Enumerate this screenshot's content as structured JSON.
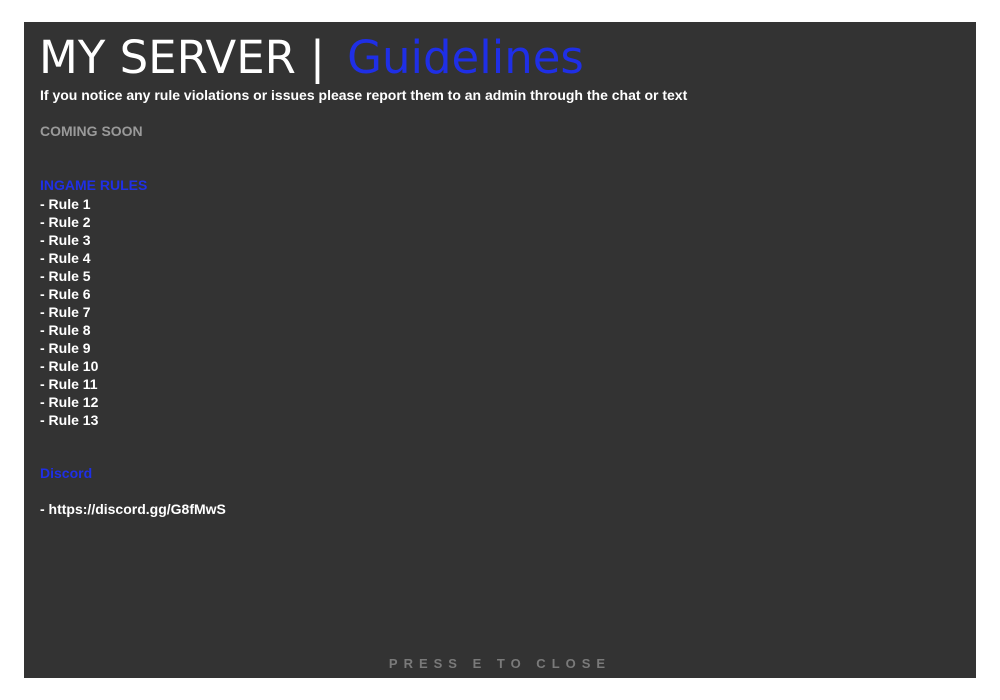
{
  "header": {
    "title_server": "MY SERVER",
    "title_separator": "|",
    "title_guidelines": "Guidelines"
  },
  "notice": "If you notice any rule violations or issues please report them to an admin through the chat or text",
  "coming_soon": "COMING SOON",
  "ingame_rules": {
    "heading": "INGAME RULES",
    "items": [
      "- Rule 1",
      "- Rule 2",
      "- Rule 3",
      "- Rule 4",
      "- Rule 5",
      "- Rule 6",
      "- Rule 7",
      "- Rule 8",
      "- Rule 9",
      "- Rule 10",
      "- Rule 11",
      "- Rule 12",
      "- Rule 13"
    ]
  },
  "discord": {
    "heading": "Discord",
    "link": "- https://discord.gg/G8fMwS"
  },
  "footer": {
    "close_hint": "PRESS E TO CLOSE"
  },
  "colors": {
    "panel_background": "#333333",
    "accent_blue": "#1f2fe6",
    "muted_gray": "#9a9a9a",
    "text_white": "#ffffff"
  }
}
